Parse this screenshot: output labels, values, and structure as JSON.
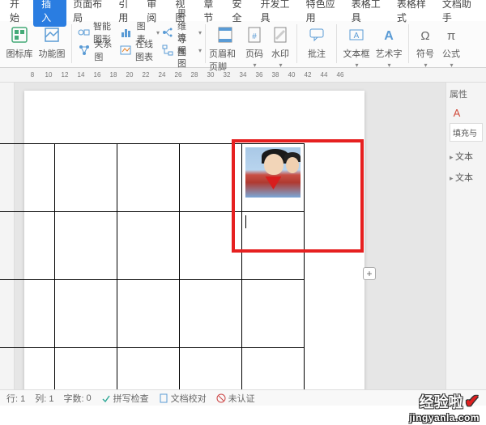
{
  "menu": {
    "items": [
      "开始",
      "插入",
      "页面布局",
      "引用",
      "审阅",
      "视图",
      "章节",
      "安全",
      "开发工具",
      "特色应用",
      "表格工具",
      "表格样式",
      "文档助手"
    ],
    "active_index": 1
  },
  "toolbar": {
    "iconlib": "图标库",
    "features": "功能图",
    "smartshape": "智能图形",
    "chart": "图表",
    "relation": "关系图",
    "onlinechart": "在线图表",
    "mindmap": "思维导图",
    "flowchart": "流程图",
    "headerfooter": "页眉和页脚",
    "pagenum": "页码",
    "watermark": "水印",
    "comment": "批注",
    "textbox": "文本框",
    "wordart": "艺术字",
    "symbol": "符号",
    "formula": "公式"
  },
  "ruler": {
    "marks": [
      "8",
      "10",
      "12",
      "14",
      "16",
      "18",
      "20",
      "22",
      "24",
      "26",
      "28",
      "30",
      "32",
      "34",
      "36",
      "38",
      "40",
      "42",
      "44",
      "46"
    ]
  },
  "rpanel": {
    "header": "属性",
    "tab": "填充与",
    "item1": "文本",
    "item2": "文本"
  },
  "status": {
    "row": "行: 1",
    "col": "列: 1",
    "words_label": "字数:",
    "words_value": "0",
    "spell": "拼写检查",
    "docfix": "文档校对",
    "uncert": "未认证"
  },
  "watermark": {
    "line1": "经验啦",
    "line2": "jingyanla.com"
  },
  "misc": {
    "plus": "+"
  }
}
